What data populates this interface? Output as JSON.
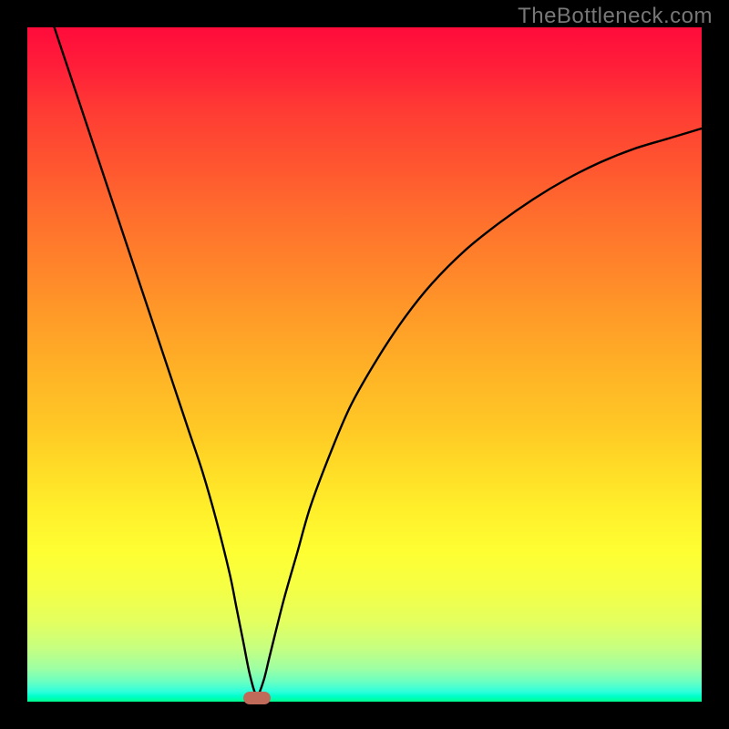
{
  "watermark": "TheBottleneck.com",
  "chart_data": {
    "type": "line",
    "title": "",
    "xlabel": "",
    "ylabel": "",
    "xlim": [
      0,
      100
    ],
    "ylim": [
      0,
      100
    ],
    "grid": false,
    "legend": false,
    "series": [
      {
        "name": "bottleneck-curve",
        "x": [
          4,
          6,
          8,
          10,
          12,
          14,
          16,
          18,
          20,
          22,
          24,
          26,
          28,
          30,
          31,
          32,
          33,
          34,
          35,
          36,
          38,
          40,
          42,
          45,
          48,
          52,
          56,
          60,
          65,
          70,
          75,
          80,
          85,
          90,
          95,
          100
        ],
        "y": [
          100,
          94,
          88,
          82,
          76,
          70,
          64,
          58,
          52,
          46,
          40,
          34,
          27,
          19,
          14,
          9,
          4,
          1,
          3,
          7,
          15,
          22,
          29,
          37,
          44,
          51,
          57,
          62,
          67,
          71,
          74.5,
          77.5,
          80,
          82,
          83.5,
          85
        ]
      }
    ],
    "annotations": [
      {
        "name": "optimum-marker",
        "x": 34,
        "y": 0
      }
    ],
    "background_gradient": {
      "type": "vertical",
      "stops": [
        {
          "pos": 0,
          "color": "#ff0b3b"
        },
        {
          "pos": 50,
          "color": "#ffb526"
        },
        {
          "pos": 78,
          "color": "#feff33"
        },
        {
          "pos": 100,
          "color": "#00ff8e"
        }
      ]
    },
    "curve_stroke": "#000000",
    "marker_color": "#c06a5a"
  }
}
